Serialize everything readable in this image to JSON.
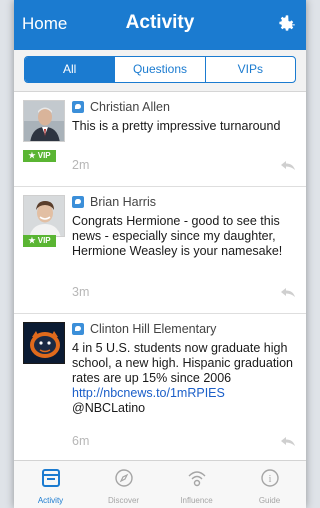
{
  "header": {
    "home_label": "Home",
    "title": "Activity",
    "settings_icon": "gear-icon"
  },
  "segments": [
    {
      "label": "All",
      "active": true
    },
    {
      "label": "Questions",
      "active": false
    },
    {
      "label": "VIPs",
      "active": false
    }
  ],
  "feed": [
    {
      "author": "Christian Allen",
      "text": "This is a pretty impressive turnaround",
      "vip": "★ VIP",
      "time": "2m",
      "source_icon": "twitter-icon"
    },
    {
      "author": "Brian Harris",
      "text": "Congrats Hermione - good to see this news - especially since my daughter, Hermione Weasley is your namesake!",
      "vip": "★ VIP",
      "time": "3m",
      "source_icon": "twitter-icon"
    },
    {
      "author": "Clinton Hill Elementary",
      "text_before": "4 in 5 U.S. students now graduate high school, a new high. Hispanic graduation rates are up 15% since 2006 ",
      "link": "http://nbcnews.to/1mRPIES",
      "text_after": " @NBCLatino",
      "time": "6m",
      "source_icon": "twitter-icon"
    }
  ],
  "tabbar": [
    {
      "label": "Activity",
      "icon": "activity-icon",
      "active": true
    },
    {
      "label": "Discover",
      "icon": "compass-icon",
      "active": false
    },
    {
      "label": "Influence",
      "icon": "signal-icon",
      "active": false
    },
    {
      "label": "Guide",
      "icon": "info-icon",
      "active": false
    }
  ],
  "colors": {
    "brand_blue": "#1b7bd0",
    "vip_green": "#5ab533",
    "link_blue": "#1b5fc9"
  }
}
